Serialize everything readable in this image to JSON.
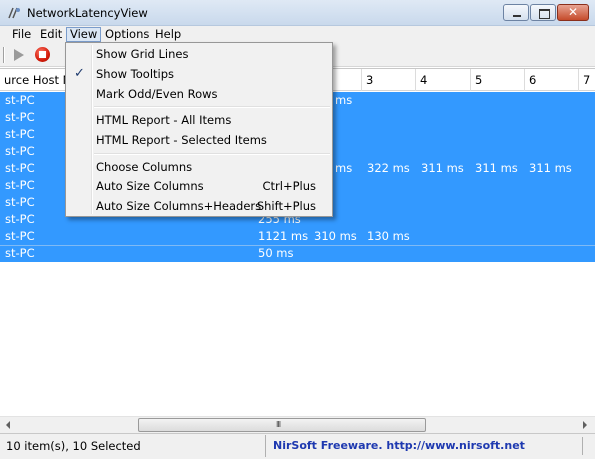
{
  "window": {
    "title": "NetworkLatencyView"
  },
  "menubar": [
    "File",
    "Edit",
    "View",
    "Options",
    "Help"
  ],
  "columns": [
    "urce Host Na",
    "",
    "3",
    "4",
    "5",
    "6",
    "7"
  ],
  "rows": [
    {
      "host": "st-PC",
      "v1": "ms",
      "v2": "",
      "v3": "",
      "v4": "",
      "v5": "",
      "v6": ""
    },
    {
      "host": "st-PC",
      "v1": "",
      "v2": "",
      "v3": "",
      "v4": "",
      "v5": "",
      "v6": ""
    },
    {
      "host": "st-PC",
      "v1": "",
      "v2": "",
      "v3": "",
      "v4": "",
      "v5": "",
      "v6": ""
    },
    {
      "host": "st-PC",
      "v1": "",
      "v2": "",
      "v3": "",
      "v4": "",
      "v5": "",
      "v6": ""
    },
    {
      "host": "st-PC",
      "v1": "ms",
      "v2": "322 ms",
      "v3": "311 ms",
      "v4": "311 ms",
      "v5": "311 ms",
      "v6": ""
    },
    {
      "host": "st-PC",
      "v1": "",
      "v2": "",
      "v3": "",
      "v4": "",
      "v5": "",
      "v6": ""
    },
    {
      "host": "st-PC",
      "v1": "",
      "v2": "",
      "v3": "",
      "v4": "",
      "v5": "",
      "v6": ""
    },
    {
      "host": "st-PC",
      "v1": "255 ms",
      "v2": "",
      "v3": "",
      "v4": "",
      "v5": "",
      "v6": ""
    },
    {
      "host": "st-PC",
      "v1": "1121 ms",
      "v2": "310 ms",
      "v3": "130 ms",
      "v4": "",
      "v5": "",
      "v6": ""
    },
    {
      "host": "st-PC",
      "v1": "50 ms",
      "v2": "",
      "v3": "",
      "v4": "",
      "v5": "",
      "v6": ""
    }
  ],
  "view_menu": {
    "show_grid_lines": "Show Grid Lines",
    "show_tooltips": "Show Tooltips",
    "show_tooltips_checked": true,
    "mark_odd_even": "Mark Odd/Even Rows",
    "html_all": "HTML Report - All Items",
    "html_selected": "HTML Report - Selected Items",
    "choose_columns": "Choose Columns",
    "auto_size": "Auto Size Columns",
    "auto_size_shortcut": "Ctrl+Plus",
    "auto_size_headers": "Auto Size Columns+Headers",
    "auto_size_headers_shortcut": "Shift+Plus"
  },
  "status": {
    "items": "10 item(s), 10 Selected",
    "link": "NirSoft Freeware.  http://www.nirsoft.net"
  },
  "colors": {
    "selection": "#3399ff",
    "link": "#1e39b0"
  }
}
